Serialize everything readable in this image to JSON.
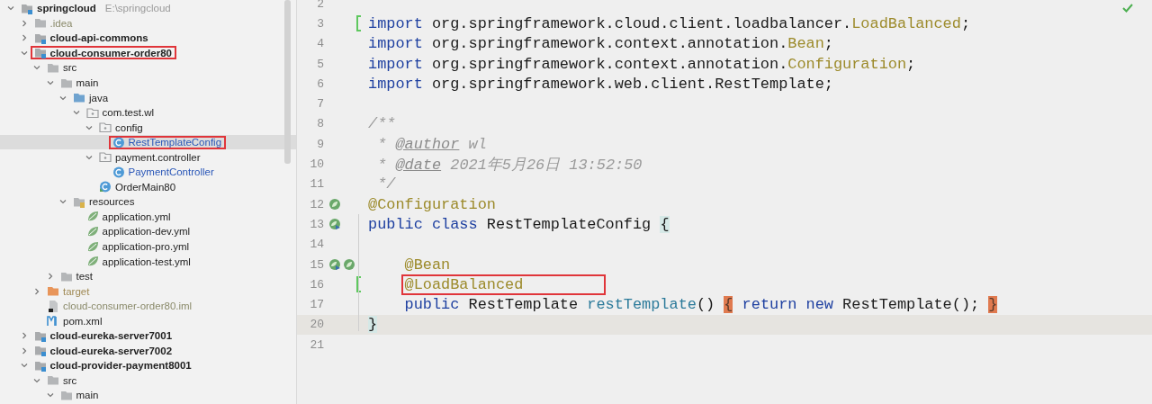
{
  "project_tree": {
    "items": [
      {
        "label": "springcloud",
        "hint": "E:\\springcloud",
        "kind": "module",
        "expanded": true,
        "selected": false,
        "boxed": false,
        "children": [
          {
            "label": ".idea",
            "kind": "folder-dim",
            "expanded": false,
            "selected": false,
            "boxed": false
          },
          {
            "label": "cloud-api-commons",
            "kind": "module",
            "expanded": false,
            "selected": false,
            "boxed": false
          },
          {
            "label": "cloud-consumer-order80",
            "kind": "module",
            "expanded": true,
            "selected": false,
            "boxed": true,
            "children": [
              {
                "label": "src",
                "kind": "folder",
                "expanded": true,
                "selected": false,
                "boxed": false,
                "children": [
                  {
                    "label": "main",
                    "kind": "folder",
                    "expanded": true,
                    "selected": false,
                    "boxed": false,
                    "children": [
                      {
                        "label": "java",
                        "kind": "source-folder",
                        "expanded": true,
                        "selected": false,
                        "boxed": false,
                        "children": [
                          {
                            "label": "com.test.wl",
                            "kind": "package",
                            "expanded": true,
                            "selected": false,
                            "boxed": false,
                            "children": [
                              {
                                "label": "config",
                                "kind": "package",
                                "expanded": true,
                                "selected": false,
                                "boxed": false,
                                "children": [
                                  {
                                    "label": "RestTemplateConfig",
                                    "kind": "class",
                                    "selected": true,
                                    "boxed": true
                                  }
                                ]
                              },
                              {
                                "label": "payment.controller",
                                "kind": "package",
                                "expanded": true,
                                "selected": false,
                                "boxed": false,
                                "children": [
                                  {
                                    "label": "PaymentController",
                                    "kind": "class",
                                    "selected": false,
                                    "boxed": false
                                  }
                                ]
                              },
                              {
                                "label": "OrderMain80",
                                "kind": "main-class",
                                "selected": false,
                                "boxed": false
                              }
                            ]
                          }
                        ]
                      },
                      {
                        "label": "resources",
                        "kind": "resources",
                        "expanded": true,
                        "selected": false,
                        "boxed": false,
                        "children": [
                          {
                            "label": "application.yml",
                            "kind": "yml",
                            "selected": false,
                            "boxed": false
                          },
                          {
                            "label": "application-dev.yml",
                            "kind": "yml",
                            "selected": false,
                            "boxed": false
                          },
                          {
                            "label": "application-pro.yml",
                            "kind": "yml",
                            "selected": false,
                            "boxed": false
                          },
                          {
                            "label": "application-test.yml",
                            "kind": "yml",
                            "selected": false,
                            "boxed": false
                          }
                        ]
                      }
                    ]
                  },
                  {
                    "label": "test",
                    "kind": "folder",
                    "expanded": false,
                    "selected": false,
                    "boxed": false
                  }
                ]
              },
              {
                "label": "target",
                "kind": "target",
                "expanded": false,
                "selected": false,
                "boxed": false
              },
              {
                "label": "cloud-consumer-order80.iml",
                "kind": "iml",
                "selected": false,
                "boxed": false
              },
              {
                "label": "pom.xml",
                "kind": "maven",
                "selected": false,
                "boxed": false
              }
            ]
          },
          {
            "label": "cloud-eureka-server7001",
            "kind": "module",
            "expanded": false,
            "selected": false,
            "boxed": false
          },
          {
            "label": "cloud-eureka-server7002",
            "kind": "module",
            "expanded": false,
            "selected": false,
            "boxed": false
          },
          {
            "label": "cloud-provider-payment8001",
            "kind": "module",
            "expanded": true,
            "selected": false,
            "boxed": false,
            "children": [
              {
                "label": "src",
                "kind": "folder",
                "expanded": true,
                "selected": false,
                "boxed": false,
                "children": [
                  {
                    "label": "main",
                    "kind": "folder",
                    "expanded": true,
                    "selected": false,
                    "boxed": false
                  }
                ]
              }
            ]
          }
        ]
      }
    ]
  },
  "editor": {
    "lines": [
      {
        "number": "2",
        "selected": false,
        "changed": false
      },
      {
        "number": "3",
        "selected": false,
        "changed": true,
        "tokens": [
          {
            "text": "import",
            "kind": "keyword"
          },
          {
            "text": " org.springframework.cloud.client.loadbalancer.",
            "kind": "plain"
          },
          {
            "text": "LoadBalanced",
            "kind": "annotation"
          },
          {
            "text": ";",
            "kind": "plain"
          }
        ]
      },
      {
        "number": "4",
        "selected": false,
        "changed": false,
        "tokens": [
          {
            "text": "import",
            "kind": "keyword"
          },
          {
            "text": " org.springframework.context.annotation.",
            "kind": "plain"
          },
          {
            "text": "Bean",
            "kind": "annotation"
          },
          {
            "text": ";",
            "kind": "plain"
          }
        ]
      },
      {
        "number": "5",
        "selected": false,
        "changed": false,
        "tokens": [
          {
            "text": "import",
            "kind": "keyword"
          },
          {
            "text": " org.springframework.context.annotation.",
            "kind": "plain"
          },
          {
            "text": "Configuration",
            "kind": "annotation"
          },
          {
            "text": ";",
            "kind": "plain"
          }
        ]
      },
      {
        "number": "6",
        "selected": false,
        "changed": false,
        "tokens": [
          {
            "text": "import",
            "kind": "keyword"
          },
          {
            "text": " org.springframework.web.client.RestTemplate;",
            "kind": "plain"
          }
        ]
      },
      {
        "number": "7",
        "selected": false,
        "changed": false
      },
      {
        "number": "8",
        "selected": false,
        "changed": false,
        "tokens": [
          {
            "text": "/**",
            "kind": "comment"
          }
        ]
      },
      {
        "number": "9",
        "selected": false,
        "changed": false,
        "tokens": [
          {
            "text": " * ",
            "kind": "comment"
          },
          {
            "text": "@author",
            "kind": "doc-tag"
          },
          {
            "text": " wl",
            "kind": "comment"
          }
        ]
      },
      {
        "number": "10",
        "selected": false,
        "changed": false,
        "tokens": [
          {
            "text": " * ",
            "kind": "comment"
          },
          {
            "text": "@date",
            "kind": "doc-tag"
          },
          {
            "text": " 2021年5月26日 13:52:50",
            "kind": "comment"
          }
        ]
      },
      {
        "number": "11",
        "selected": false,
        "changed": false,
        "tokens": [
          {
            "text": " */",
            "kind": "comment"
          }
        ]
      },
      {
        "number": "12",
        "selected": false,
        "changed": false,
        "gutter": [
          {
            "kind": "bean"
          }
        ],
        "tokens": [
          {
            "text": "@Configuration",
            "kind": "annotation"
          }
        ]
      },
      {
        "number": "13",
        "selected": false,
        "changed": false,
        "gutter": [
          {
            "kind": "bean-nav"
          }
        ],
        "tokens": [
          {
            "text": "public",
            "kind": "keyword"
          },
          {
            "text": " class",
            "kind": "keyword"
          },
          {
            "text": " RestTemplateConfig ",
            "kind": "plain"
          },
          {
            "text": "{",
            "kind": "brace-match"
          }
        ]
      },
      {
        "number": "14",
        "selected": false,
        "changed": false
      },
      {
        "number": "15",
        "selected": false,
        "changed": false,
        "gutter": [
          {
            "kind": "bean-nav"
          },
          {
            "kind": "bean"
          }
        ],
        "tokens": [
          {
            "text": "    @Bean",
            "kind": "annotation"
          }
        ]
      },
      {
        "number": "16",
        "selected": false,
        "changed": true,
        "tokens": [
          {
            "text": "    @LoadBalanced",
            "kind": "annotation",
            "boxed": true
          }
        ]
      },
      {
        "number": "17",
        "selected": false,
        "changed": false,
        "tokens": [
          {
            "text": "    public",
            "kind": "keyword"
          },
          {
            "text": " RestTemplate ",
            "kind": "plain"
          },
          {
            "text": "restTemplate",
            "kind": "method"
          },
          {
            "text": "() ",
            "kind": "plain"
          },
          {
            "text": "{",
            "kind": "fold"
          },
          {
            "text": " return",
            "kind": "keyword"
          },
          {
            "text": " new",
            "kind": "keyword"
          },
          {
            "text": " RestTemplate(); ",
            "kind": "plain"
          },
          {
            "text": "}",
            "kind": "fold"
          }
        ]
      },
      {
        "number": "20",
        "selected": true,
        "changed": false,
        "tokens": [
          {
            "text": "}",
            "kind": "brace-match"
          }
        ]
      },
      {
        "number": "21",
        "selected": false,
        "changed": false
      }
    ]
  }
}
